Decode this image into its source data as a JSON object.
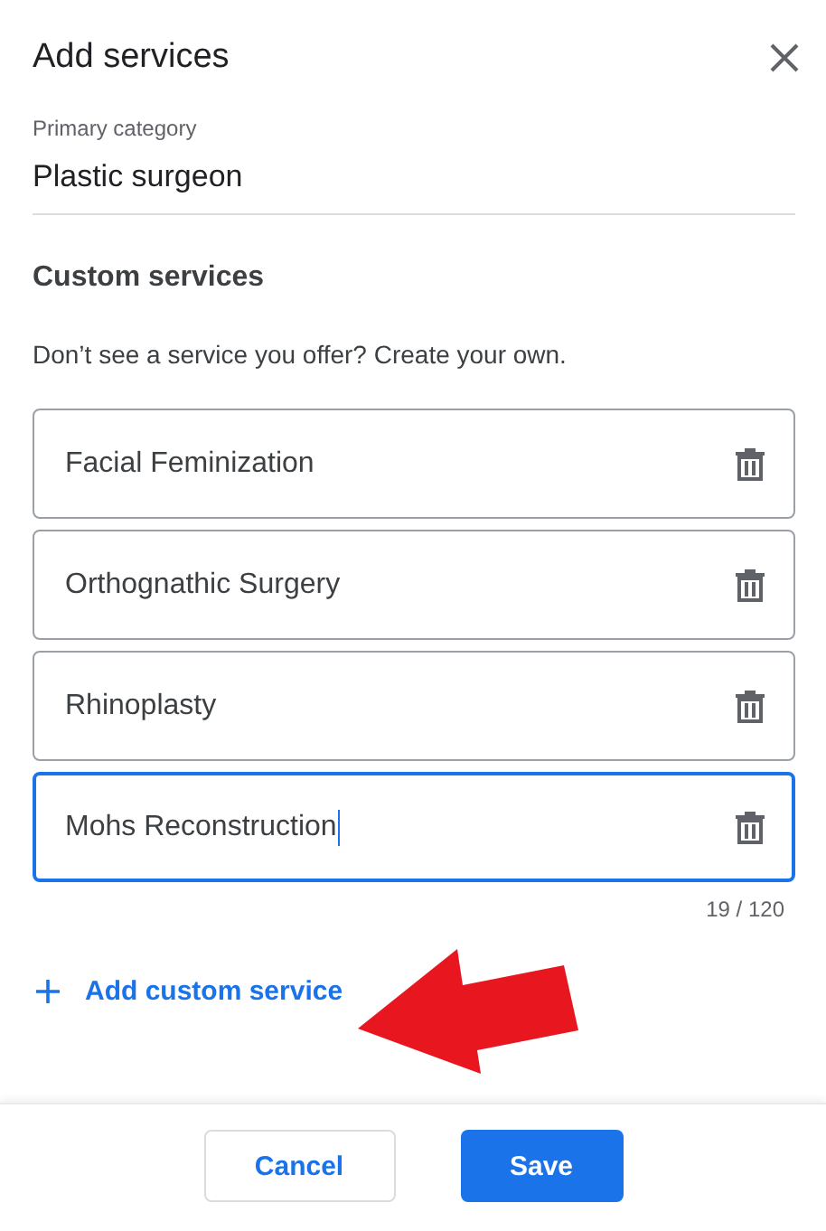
{
  "dialog": {
    "title": "Add services"
  },
  "primary_category": {
    "label": "Primary category",
    "value": "Plastic surgeon"
  },
  "custom_services": {
    "heading": "Custom services",
    "description": "Don’t see a service you offer? Create your own.",
    "fields": [
      {
        "value": "Facial Feminization",
        "focused": false
      },
      {
        "value": "Orthognathic Surgery",
        "focused": false
      },
      {
        "value": "Rhinoplasty",
        "focused": false
      },
      {
        "value": "Mohs Reconstruction",
        "focused": true
      }
    ],
    "counter": "19 / 120",
    "add_label": "Add custom service"
  },
  "buttons": [
    {
      "kind": "secondary",
      "label": "Cancel"
    },
    {
      "kind": "primary",
      "label": "Save"
    }
  ]
}
